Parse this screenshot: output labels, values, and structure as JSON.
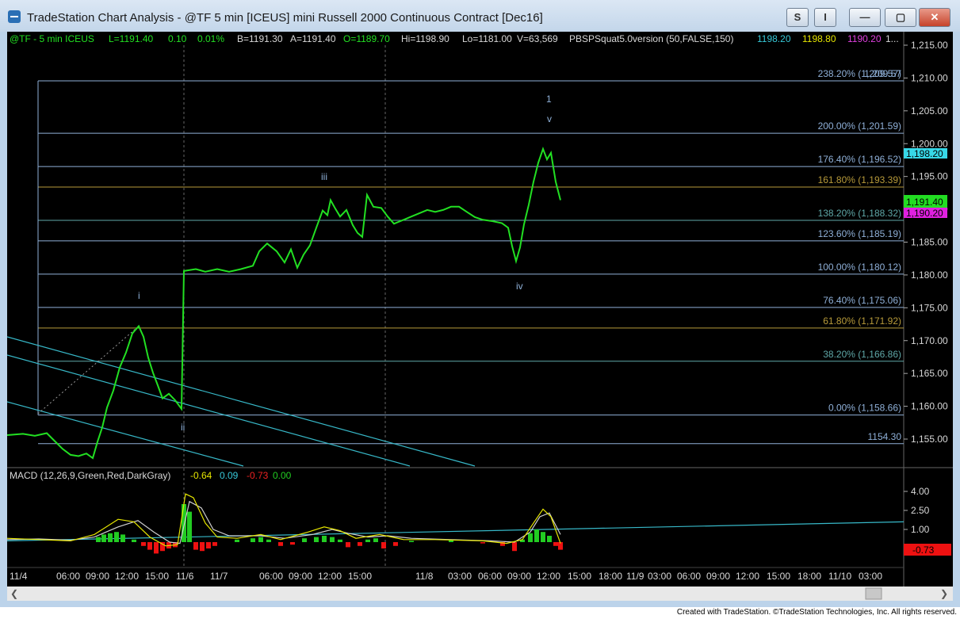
{
  "window": {
    "title": "TradeStation Chart Analysis - @TF 5 min [ICEUS] mini Russell 2000 Continuous Contract [Dec16]",
    "buttons": {
      "s_label": "S",
      "i_label": "I"
    }
  },
  "header": {
    "symbol": "@TF - 5 min  ICEUS",
    "last": "L=1191.40",
    "change": "0.10",
    "pct": "0.01%",
    "bid": "B=1191.30",
    "ask": "A=1191.40",
    "open": "O=1189.70",
    "hi": "Hi=1198.90",
    "lo": "Lo=1181.00",
    "vol": "V=63,569",
    "indicator": "PBSPSquat5.0version (50,FALSE,150)",
    "ind_v1": "1198.20",
    "ind_v2": "1198.80",
    "ind_v3": "1190.20",
    "ind_v4": "1..."
  },
  "price_axis": {
    "ticks": [
      "1,215.00",
      "1,210.00",
      "1,205.00",
      "1,200.00",
      "1,195.00",
      "1,190.00",
      "1,185.00",
      "1,180.00",
      "1,175.00",
      "1,170.00",
      "1,165.00",
      "1,160.00",
      "1,155.00"
    ],
    "tick_values": [
      1215,
      1210,
      1205,
      1200,
      1195,
      1190,
      1185,
      1180,
      1175,
      1170,
      1165,
      1160,
      1155
    ],
    "label_cyan": "1,198.20",
    "label_green": "1,191.40",
    "label_magenta": "1,190.20"
  },
  "fib_levels": [
    {
      "label": "238.20% (1,209.57)",
      "value": 1209.57,
      "color": "#8fb0d8"
    },
    {
      "label": "200.00% (1,201.59)",
      "value": 1201.59,
      "color": "#8fb0d8"
    },
    {
      "label": "176.40% (1,196.52)",
      "value": 1196.52,
      "color": "#8fb0d8"
    },
    {
      "label": "161.80% (1,193.39)",
      "value": 1193.39,
      "color": "#b79a3a"
    },
    {
      "label": "138.20% (1,188.32)",
      "value": 1188.32,
      "color": "#5fa8a8"
    },
    {
      "label": "123.60% (1,185.19)",
      "value": 1185.19,
      "color": "#8fb0d8"
    },
    {
      "label": "100.00% (1,180.12)",
      "value": 1180.12,
      "color": "#8fb0d8"
    },
    {
      "label": "76.40% (1,175.06)",
      "value": 1175.06,
      "color": "#8fb0d8"
    },
    {
      "label": "61.80% (1,171.92)",
      "value": 1171.92,
      "color": "#b79a3a"
    },
    {
      "label": "38.20% (1,166.86)",
      "value": 1166.86,
      "color": "#5fa8a8"
    },
    {
      "label": "0.00% (1,158.66)",
      "value": 1158.66,
      "color": "#8fb0d8"
    },
    {
      "label": "1154.30",
      "value": 1154.3,
      "color": "#8fb0d8"
    }
  ],
  "extra_fib_label": "1,209.57",
  "wave_labels": [
    "i",
    "ii",
    "iii",
    "iv",
    "v",
    "1"
  ],
  "macd": {
    "title": "MACD (12,26,9,Green,Red,DarkGray)",
    "v1": "-0.64",
    "v2": "0.09",
    "v3": "-0.73",
    "v4": "0.00",
    "ticks": [
      "4.00",
      "2.50",
      "1.00"
    ],
    "tick_values": [
      4,
      2.5,
      1
    ],
    "last_label": "-0.73"
  },
  "time_axis": {
    "labels": [
      "11/4",
      "06:00",
      "09:00",
      "12:00",
      "15:00",
      "11/6",
      "11/7",
      "06:00",
      "09:00",
      "12:00",
      "15:00",
      "11/8",
      "03:00",
      "06:00",
      "09:00",
      "12:00",
      "15:00",
      "18:00",
      "11/9",
      "03:00",
      "06:00",
      "09:00",
      "12:00",
      "15:00",
      "18:00",
      "11/10",
      "03:00"
    ]
  },
  "footer": "Created with TradeStation. ©TradeStation Technologies, Inc. All rights reserved.",
  "colors": {
    "price": "#22e022",
    "fib_line": "#8fb0d8",
    "trend_line": "#37b8c8",
    "macd_pos": "#22cc22",
    "macd_neg": "#ee1111",
    "label_yellow": "#e6e600"
  }
}
